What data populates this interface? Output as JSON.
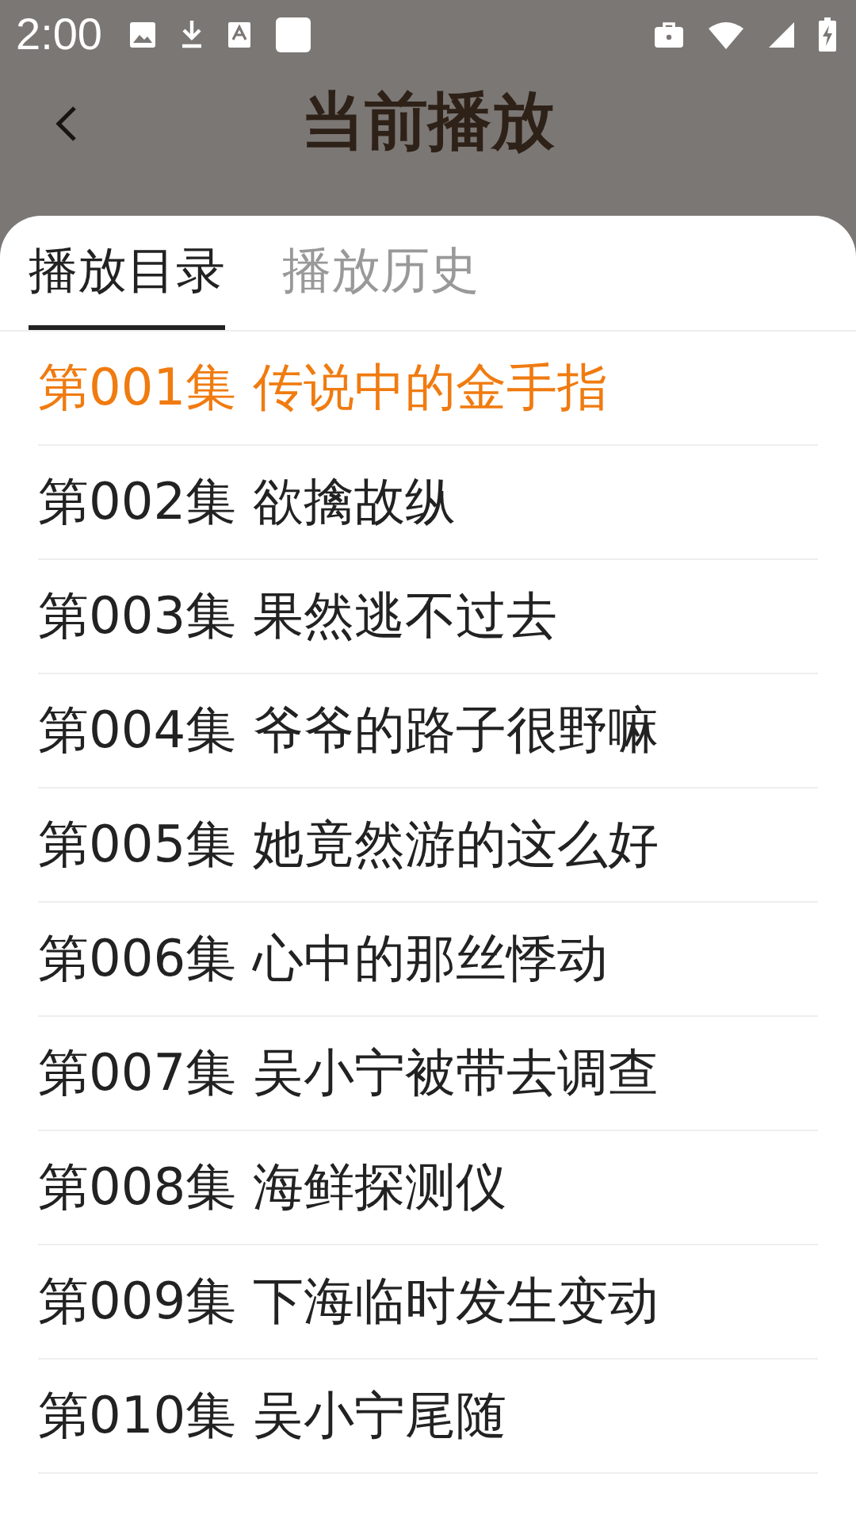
{
  "status_bar": {
    "time": "2:00"
  },
  "header": {
    "title": "当前播放"
  },
  "tabs": [
    {
      "label": "播放目录",
      "selected": true
    },
    {
      "label": "播放历史",
      "selected": false
    }
  ],
  "episodes": [
    {
      "title": "第001集 传说中的金手指",
      "selected": true
    },
    {
      "title": "第002集 欲擒故纵",
      "selected": false
    },
    {
      "title": "第003集 果然逃不过去",
      "selected": false
    },
    {
      "title": "第004集 爷爷的路子很野嘛",
      "selected": false
    },
    {
      "title": "第005集 她竟然游的这么好",
      "selected": false
    },
    {
      "title": "第006集 心中的那丝悸动",
      "selected": false
    },
    {
      "title": "第007集 吴小宁被带去调查",
      "selected": false
    },
    {
      "title": "第008集 海鲜探测仪",
      "selected": false
    },
    {
      "title": "第009集 下海临时发生变动",
      "selected": false
    },
    {
      "title": "第010集 吴小宁尾随",
      "selected": false
    }
  ]
}
